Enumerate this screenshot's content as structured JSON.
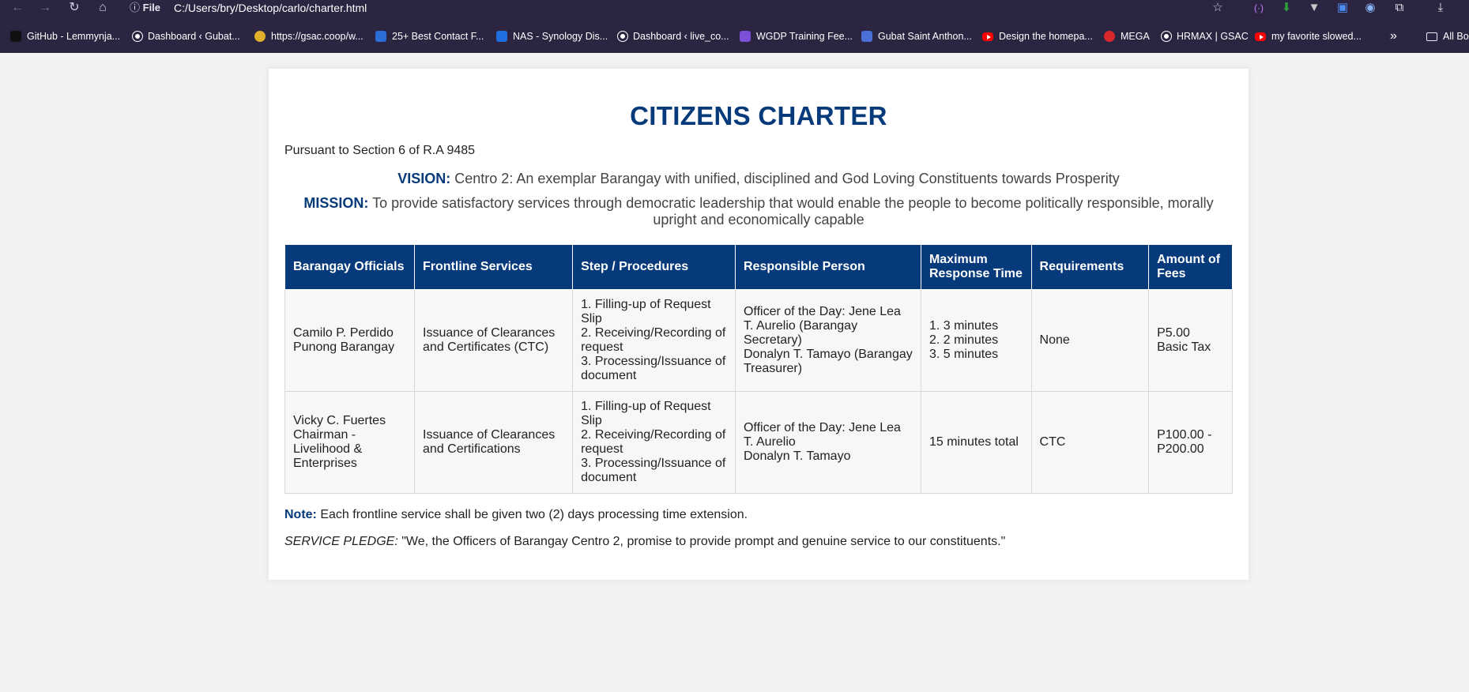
{
  "browser": {
    "file_label": "File",
    "url": "C:/Users/bry/Desktop/carlo/charter.html",
    "bookmarks": [
      {
        "label": "GitHub - Lemmynja...",
        "icon": "github-icon"
      },
      {
        "label": "Dashboard ‹ Gubat...",
        "icon": "globe-icon"
      },
      {
        "label": "https://gsac.coop/w...",
        "icon": "gsac-icon"
      },
      {
        "label": "25+ Best Contact F...",
        "icon": "bookmark-icon"
      },
      {
        "label": "NAS - Synology Dis...",
        "icon": "dsm-icon"
      },
      {
        "label": "Dashboard ‹ live_co...",
        "icon": "globe-icon"
      },
      {
        "label": "WGDP Training Fee...",
        "icon": "forms-icon"
      },
      {
        "label": "Gubat Saint Anthon...",
        "icon": "calendar-icon"
      },
      {
        "label": "Design the homepa...",
        "icon": "youtube-icon"
      },
      {
        "label": "MEGA",
        "icon": "mega-icon"
      },
      {
        "label": "HRMAX | GSAC",
        "icon": "globe-icon"
      },
      {
        "label": "my favorite slowed...",
        "icon": "youtube-icon"
      }
    ],
    "overflow_label": "»",
    "all_bookmarks_label": "All Bo"
  },
  "page": {
    "title": "CITIZENS CHARTER",
    "pursuant": "Pursuant to Section 6 of R.A 9485",
    "vision_label": "VISION:",
    "vision_text": "Centro 2: An exemplar Barangay with unified, disciplined and God Loving Constituents towards Prosperity",
    "mission_label": "MISSION:",
    "mission_text": "To provide satisfactory services through democratic leadership that would enable the people to become politically responsible, morally upright and economically capable",
    "table": {
      "headers": [
        "Barangay Officials",
        "Frontline Services",
        "Step / Procedures",
        "Responsible Person",
        "Maximum Response Time",
        "Requirements",
        "Amount of Fees"
      ],
      "rows": [
        [
          "Camilo P. Perdido\nPunong Barangay",
          "Issuance of Clearances and Certificates (CTC)",
          "1. Filling-up of Request Slip\n2. Receiving/Recording of request\n3. Processing/Issuance of document",
          "Officer of the Day: Jene Lea T. Aurelio (Barangay Secretary)\nDonalyn T. Tamayo (Barangay Treasurer)",
          "1. 3 minutes\n2. 2 minutes\n3. 5 minutes",
          "None",
          "P5.00 Basic Tax"
        ],
        [
          "Vicky C. Fuertes\nChairman - Livelihood & Enterprises",
          "Issuance of Clearances and Certifications",
          "1. Filling-up of Request Slip\n2. Receiving/Recording of request\n3. Processing/Issuance of document",
          "Officer of the Day: Jene Lea T. Aurelio\nDonalyn T. Tamayo",
          "15 minutes total",
          "CTC",
          "P100.00 - P200.00"
        ]
      ]
    },
    "note_label": "Note:",
    "note_text": "Each frontline service shall be given two (2) days processing time extension.",
    "pledge_label": "SERVICE PLEDGE:",
    "pledge_text": "\"We, the Officers of Barangay Centro 2, promise to provide prompt and genuine service to our constituents.\""
  }
}
